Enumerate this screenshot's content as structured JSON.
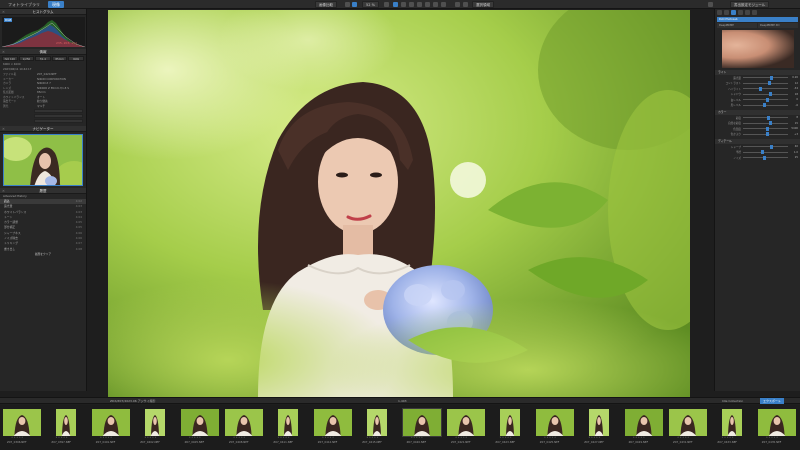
{
  "tabs": {
    "library": "フォトライブラリ",
    "edit": "現像"
  },
  "toolbar": {
    "compare_label": "画像比較",
    "zoom_value": "52 %",
    "tone_label": "選択領域",
    "export_setting": "書出設定モジュール",
    "export_btn": "エクスポート"
  },
  "left": {
    "histogram_title": "ヒストグラム",
    "histogram_tab": "RGB",
    "rgb_readout": "235, 203, 151",
    "info_title": "情報",
    "btn_row1": [
      "ISO 100",
      "1/250",
      "f/1.4",
      "85mm",
      "RAW"
    ],
    "meta_size": "6000 × 4000",
    "meta_date": "2023/06/11 10:42:17",
    "meta_rows": [
      {
        "k": "ファイル名",
        "v": "Z07_0420.NEF"
      },
      {
        "k": "メーカー",
        "v": "NIKON CORPORATION"
      },
      {
        "k": "カメラ",
        "v": "NIKON Z 7"
      },
      {
        "k": "レンズ",
        "v": "NIKKOR Z 85mm f/1.8 S"
      },
      {
        "k": "焦点距離",
        "v": "85mm"
      },
      {
        "k": "ホワイトバランス",
        "v": "オート"
      },
      {
        "k": "露出モード",
        "v": "絞り優先"
      },
      {
        "k": "測光",
        "v": "マルチ"
      }
    ],
    "nav_title": "ナビゲーター",
    "history_title": "履歴",
    "history_sub": "Advanced History",
    "history_items": [
      {
        "name": "読込",
        "meta": "4:02"
      },
      {
        "name": "露光量",
        "meta": "4:03"
      },
      {
        "name": "ホワイトバランス",
        "meta": "4:03"
      },
      {
        "name": "トーン",
        "meta": "4:04"
      },
      {
        "name": "カラー調整",
        "meta": "4:05"
      },
      {
        "name": "部分補正",
        "meta": "4:05"
      },
      {
        "name": "シャープネス",
        "meta": "4:06"
      },
      {
        "name": "ノイズ除去",
        "meta": "4:06"
      },
      {
        "name": "トリミング",
        "meta": "4:07"
      },
      {
        "name": "書き出し",
        "meta": "4:08"
      }
    ],
    "history_footer": "履歴をクリア"
  },
  "right": {
    "module_title": "DxO PhotoLab",
    "tabs": [
      "DeepPRIME",
      "DeepPRIME XD"
    ],
    "sec_light": "ライト",
    "sliders": [
      {
        "label": "露光量",
        "value": "0.20",
        "pos": 60
      },
      {
        "label": "コントラスト",
        "value": "12",
        "pos": 55
      },
      {
        "label": "ハイライト",
        "value": "-34",
        "pos": 35
      },
      {
        "label": "シャドウ",
        "value": "18",
        "pos": 58
      },
      {
        "label": "白レベル",
        "value": "0",
        "pos": 50
      },
      {
        "label": "黒レベル",
        "value": "-6",
        "pos": 45
      }
    ],
    "sec_color": "カラー",
    "sliders2": [
      {
        "label": "彩度",
        "value": "8",
        "pos": 54
      },
      {
        "label": "自然な彩度",
        "value": "15",
        "pos": 57
      },
      {
        "label": "色温度",
        "value": "5400",
        "pos": 52
      },
      {
        "label": "色かぶり",
        "value": "+3",
        "pos": 51
      }
    ],
    "sec_detail": "ディテール",
    "sliders3": [
      {
        "label": "シャープ",
        "value": "40",
        "pos": 60
      },
      {
        "label": "半径",
        "value": "1.0",
        "pos": 40
      },
      {
        "label": "ノイズ",
        "value": "25",
        "pos": 45
      }
    ]
  },
  "status": {
    "folder": "ZDX/Z07/2023.06 アジサイ撮影",
    "count": "1,403",
    "filter": "Idle Collection"
  },
  "filmstrip": [
    "Z07_0396.NEF",
    "Z07_0397.NEF",
    "Z07_0401.NEF",
    "Z07_0402.NEF",
    "Z07_0405.NEF",
    "Z07_0408.NEF",
    "Z07_0411.NEF",
    "Z07_0412.NEF",
    "Z07_0415.NEF",
    "Z07_0420.NEF",
    "Z07_0421.NEF",
    "Z07_0423.NEF",
    "Z07_0425.NEF",
    "Z07_0427.NEF",
    "Z07_0429.NEF",
    "Z07_0431.NEF",
    "Z07_0433.NEF",
    "Z07_0435.NEF"
  ]
}
